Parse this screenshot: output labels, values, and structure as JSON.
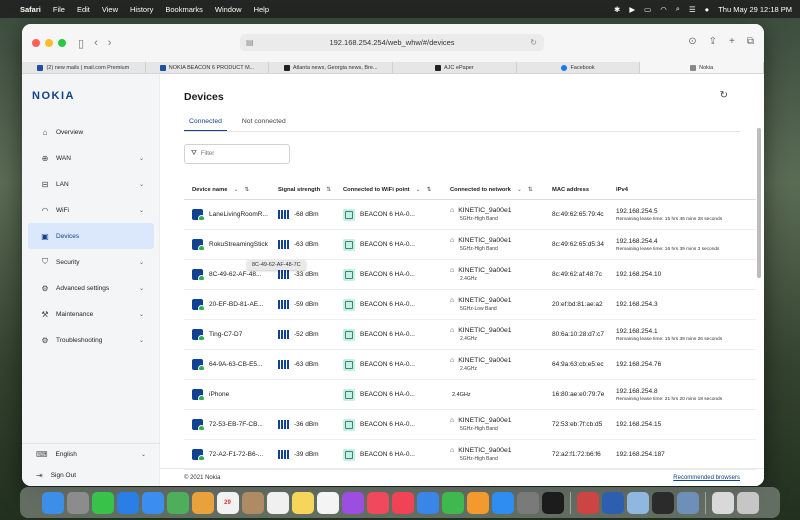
{
  "menubar": {
    "app_name": "Safari",
    "menus": [
      "File",
      "Edit",
      "View",
      "History",
      "Bookmarks",
      "Window",
      "Help"
    ],
    "datetime": "Thu May 29  12:18 PM"
  },
  "browser": {
    "url": "192.168.254.254/web_whw/#/devices",
    "tabs": [
      {
        "label": "(2) new mails | mail.com Premium",
        "favicon_color": "#1f4fa0"
      },
      {
        "label": "NOKIA BEACON 6 PRODUCT M...",
        "favicon_color": "#1f4fa0"
      },
      {
        "label": "Atlanta news, Georgia news, Bre...",
        "favicon_color": "#222222"
      },
      {
        "label": "AJC ePaper",
        "favicon_color": "#222222"
      },
      {
        "label": "Facebook",
        "favicon_color": "#1877f2"
      },
      {
        "label": "Nokia",
        "favicon_color": "#888888"
      }
    ]
  },
  "sidebar": {
    "logo": "NOKIA",
    "items": [
      {
        "label": "Overview",
        "icon": "home-icon",
        "glyph": "⌂",
        "expandable": false,
        "active": false
      },
      {
        "label": "WAN",
        "icon": "globe-icon",
        "glyph": "⊕",
        "expandable": true,
        "active": false
      },
      {
        "label": "LAN",
        "icon": "lan-icon",
        "glyph": "⊟",
        "expandable": true,
        "active": false
      },
      {
        "label": "WiFi",
        "icon": "wifi-icon",
        "glyph": "◠",
        "expandable": true,
        "active": false
      },
      {
        "label": "Devices",
        "icon": "devices-icon",
        "glyph": "▣",
        "expandable": false,
        "active": true
      },
      {
        "label": "Security",
        "icon": "shield-icon",
        "glyph": "⛉",
        "expandable": true,
        "active": false
      },
      {
        "label": "Advanced settings",
        "icon": "gear-icon",
        "glyph": "⚙",
        "expandable": true,
        "active": false
      },
      {
        "label": "Maintenance",
        "icon": "wrench-icon",
        "glyph": "⚒",
        "expandable": true,
        "active": false
      },
      {
        "label": "Troubleshooting",
        "icon": "troubleshoot-icon",
        "glyph": "⚙",
        "expandable": true,
        "active": false
      }
    ],
    "language": "English",
    "sign_out": "Sign Out"
  },
  "main": {
    "title": "Devices",
    "tabs": [
      "Connected",
      "Not connected"
    ],
    "filter_placeholder": "Filter",
    "columns": [
      "Device name",
      "Signal strength",
      "Connected to WiFi point",
      "Connected to network",
      "MAC address",
      "IPv4"
    ],
    "tooltip": "8C-49-62-AF-48-7C",
    "rows": [
      {
        "name": "LaneLivingRoomR...",
        "signal": "-68 dBm",
        "wifi_point": "BEACON 6 HA-0...",
        "network": "KINETIC_9a00e1",
        "band": "5GHz-High Band",
        "mac": "8c:49:62:65:79:4c",
        "ip": "192.168.254.5",
        "lease": "Remaining lease time: 15 hrs 46 mins 28 seconds"
      },
      {
        "name": "RokuStreamingStick",
        "signal": "-63 dBm",
        "wifi_point": "BEACON 6 HA-0...",
        "network": "KINETIC_9a00e1",
        "band": "5GHz-High Band",
        "mac": "8c:49:62:65:d5:34",
        "ip": "192.168.254.4",
        "lease": "Remaining lease time: 16 hrs 39 mins 3 seconds"
      },
      {
        "name": "8C-49-62-AF-48...",
        "signal": "-33 dBm",
        "wifi_point": "BEACON 6 HA-0...",
        "network": "KINETIC_9a00e1",
        "band": "2.4GHz",
        "mac": "8c:49:62:af:48:7c",
        "ip": "192.168.254.10",
        "lease": ""
      },
      {
        "name": "20-EF-BD-81-AE...",
        "signal": "-59 dBm",
        "wifi_point": "BEACON 6 HA-0...",
        "network": "KINETIC_9a00e1",
        "band": "5GHz-Low Band",
        "mac": "20:ef:bd:81:ae:a2",
        "ip": "192.168.254.3",
        "lease": ""
      },
      {
        "name": "Ting-C7-D7",
        "signal": "-52 dBm",
        "wifi_point": "BEACON 6 HA-0...",
        "network": "KINETIC_9a00e1",
        "band": "2.4GHz",
        "mac": "80:6a:10:28:d7:c7",
        "ip": "192.168.254.1",
        "lease": "Remaining lease time: 15 hrs 39 mins 26 seconds"
      },
      {
        "name": "64-9A-63-CB-E5...",
        "signal": "-63 dBm",
        "wifi_point": "BEACON 6 HA-0...",
        "network": "KINETIC_9a00e1",
        "band": "2.4GHz",
        "mac": "64:9a:63:cb:e5:ec",
        "ip": "192.168.254.76",
        "lease": ""
      },
      {
        "name": "iPhone",
        "signal": "",
        "wifi_point": "BEACON 6 HA-0...",
        "network": "",
        "band": "2.4GHz",
        "mac": "16:80:ae:e0:79:7e",
        "ip": "192.168.254.8",
        "lease": "Remaining lease time: 21 hrs 20 mins 18 seconds"
      },
      {
        "name": "72-53-EB-7F-CB...",
        "signal": "-36 dBm",
        "wifi_point": "BEACON 6 HA-0...",
        "network": "KINETIC_9a00e1",
        "band": "5GHz-High Band",
        "mac": "72:53:eb:7f:cb:d5",
        "ip": "192.168.254.15",
        "lease": ""
      },
      {
        "name": "72-A2-F1-72-B6-...",
        "signal": "-39 dBm",
        "wifi_point": "BEACON 6 HA-0...",
        "network": "KINETIC_9a00e1",
        "band": "5GHz-High Band",
        "mac": "72:a2:f1:72:b6:f6",
        "ip": "192.168.254.187",
        "lease": ""
      }
    ],
    "footer_copyright": "© 2021 Nokia",
    "footer_link": "Recommended browsers"
  },
  "dock": {
    "apps": [
      {
        "name": "finder",
        "color": "#3d8ee8"
      },
      {
        "name": "launchpad",
        "color": "#8c8c8c"
      },
      {
        "name": "messages",
        "color": "#39c24a"
      },
      {
        "name": "safari",
        "color": "#2a7ee6"
      },
      {
        "name": "mail",
        "color": "#3c8df0"
      },
      {
        "name": "maps",
        "color": "#4fae5c"
      },
      {
        "name": "photos",
        "color": "#e9a23b"
      },
      {
        "name": "calendar",
        "color": "#f2f2f2",
        "text": "29"
      },
      {
        "name": "contacts",
        "color": "#b08a62"
      },
      {
        "name": "reminders",
        "color": "#f0f0f0"
      },
      {
        "name": "notes",
        "color": "#f5d65b"
      },
      {
        "name": "freeform",
        "color": "#f4f4f4"
      },
      {
        "name": "podcasts",
        "color": "#9b4ee0"
      },
      {
        "name": "music",
        "color": "#f0485c"
      },
      {
        "name": "news",
        "color": "#f04456"
      },
      {
        "name": "keynote",
        "color": "#3a86e8"
      },
      {
        "name": "numbers",
        "color": "#3fb84e"
      },
      {
        "name": "pages",
        "color": "#f39a2e"
      },
      {
        "name": "app-store",
        "color": "#2f8cf0"
      },
      {
        "name": "settings",
        "color": "#7a7a7a"
      },
      {
        "name": "apple-tv",
        "color": "#1c1c1c"
      },
      {
        "name": "other-app",
        "color": "#cc4444"
      },
      {
        "name": "other-app-2",
        "color": "#2d5fb0"
      },
      {
        "name": "preview",
        "color": "#8fb7e0"
      },
      {
        "name": "terminal",
        "color": "#2b2b2b"
      },
      {
        "name": "screen-app",
        "color": "#6e8fb8"
      },
      {
        "name": "downloads",
        "color": "#d9d9d9"
      },
      {
        "name": "trash",
        "color": "#c6c6c6"
      }
    ]
  }
}
